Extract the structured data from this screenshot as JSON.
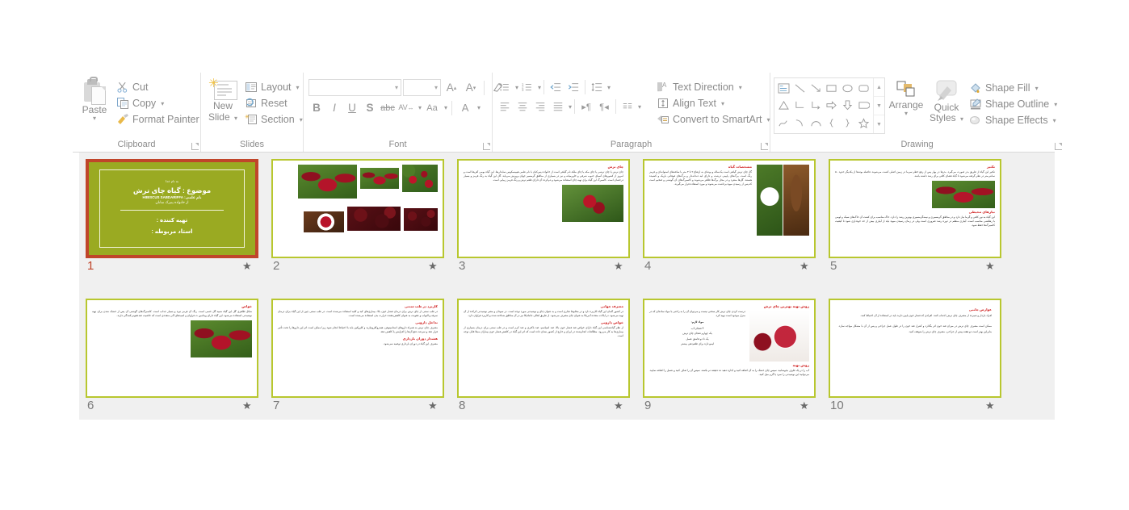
{
  "app": {
    "name": "PowerPoint Ribbon - Home Tab"
  },
  "ribbon": {
    "groups": [
      {
        "name": "Clipboard",
        "label": "Clipboard",
        "paste_label": "Paste",
        "commands": [
          {
            "label": "Cut",
            "icon": "scissors-icon"
          },
          {
            "label": "Copy",
            "icon": "copy-icon",
            "has_caret": true
          },
          {
            "label": "Format Painter",
            "icon": "format-painter-icon"
          }
        ]
      },
      {
        "name": "Slides",
        "label": "Slides",
        "new_slide_line1": "New",
        "new_slide_line2": "Slide",
        "commands": [
          {
            "label": "Layout",
            "icon": "layout-icon",
            "has_caret": true
          },
          {
            "label": "Reset",
            "icon": "reset-icon",
            "has_caret": false
          },
          {
            "label": "Section",
            "icon": "section-icon",
            "has_caret": true
          }
        ]
      },
      {
        "name": "Font",
        "label": "Font",
        "font_name_value": "",
        "font_name_placeholder": "",
        "font_size_value": "",
        "font_size_placeholder": "",
        "buttons_row1": [
          "increase-font-size",
          "decrease-font-size",
          "clear-formatting"
        ],
        "buttons_row2_labels": [
          "B",
          "I",
          "U",
          "S",
          "abc",
          "AV",
          "Aa",
          "A"
        ]
      },
      {
        "name": "Paragraph",
        "label": "Paragraph",
        "commands": [
          {
            "label": "Text Direction",
            "icon": "text-direction-icon",
            "has_caret": true
          },
          {
            "label": "Align Text",
            "icon": "align-text-icon",
            "has_caret": true
          },
          {
            "label": "Convert to SmartArt",
            "icon": "smartart-icon",
            "has_caret": true
          }
        ]
      },
      {
        "name": "Drawing",
        "label": "Drawing",
        "arrange_label": "Arrange",
        "quick_styles_line1": "Quick",
        "quick_styles_line2": "Styles",
        "commands": [
          {
            "label": "Shape Fill",
            "icon": "shape-fill-icon",
            "has_caret": true
          },
          {
            "label": "Shape Outline",
            "icon": "shape-outline-icon",
            "has_caret": true
          },
          {
            "label": "Shape Effects",
            "icon": "shape-effects-icon",
            "has_caret": true
          }
        ]
      }
    ]
  },
  "colors": {
    "selected_border": "#c0452a",
    "slide_border": "#b8c72f",
    "title_bg": "#9aaa22",
    "heading_red": "#cf1b1b",
    "workspace_bg": "#f0f0f0"
  },
  "slides": [
    {
      "number": "1",
      "selected": true,
      "has_animation": true,
      "type": "title",
      "bismillah": "به نام خدا",
      "title": "موضوع : گیاه چای ترش",
      "sci_label": "نام علمی: HIBISCUS SABDARIFFA",
      "family": "از خانواده پنیرک سانان",
      "prepared_by": "تهیه کننده :",
      "supervisor": "استاد مربوطه :"
    },
    {
      "number": "2",
      "selected": false,
      "has_animation": true,
      "type": "gallery",
      "images": [
        "hib",
        "leafy",
        "leafy",
        "dry",
        "dry",
        "cupwhite"
      ]
    },
    {
      "number": "3",
      "selected": false,
      "has_animation": true,
      "type": "text-image",
      "heading": "چای ترش",
      "body": "چای ترش یا چای ترشی یا چای مکه یا چای ملکه نام گیاهی است از خانواده پنیرکیان با نام علمی هیبیسکوس سابداریفا. این گیاه بومی آفریقا است و امروز از کشورهای آسیای جنوب شرقی و خاورمیانه و نیز در بسیاری از مناطق گرمسیر جهان پرورش می‌یابد. گل این گیاه به رنگ قرمز و بسیار درخشان است. کاسبرگ این گیاه برای تهیه چای استفاده می‌شود و دم‌کرده آن دارای طعم ترش و رنگ قرمز زیبایی است."
    },
    {
      "number": "4",
      "selected": false,
      "has_animation": true,
      "type": "image-text",
      "heading": "مشخصات گیاه",
      "body": "گل چای ترش گیاهی است یک‌ساله و بوته‌ای به ارتفاع ۲ تا ۳ متر با ساقه‌های استوانه‌ای و قرمز رنگ است. برگ‌های پایینی درشت و دارای لبه دندانه‌دار و برگ‌های فوقانی باریک و کشیده هستند. گل‌ها منفرد و در محل برگ‌ها ظاهر می‌شوند و کاسبرگ‌های آن گوشتی و ضخیم است که پس از رسیدن میوه برداشت می‌شوند و مورد استفاده قرار می‌گیرند."
    },
    {
      "number": "5",
      "selected": false,
      "has_animation": true,
      "type": "two-heading",
      "heading1": "تکثیر",
      "body1": "تکثیر این گیاه از طریق بذر صورت می‌گیرد. بذرها در بهار پس از رفع خطر سرما در زمین اصلی کشت می‌شوند. فاصله بوته‌ها از یکدیگر حدود ۵۰ سانتی‌متر در نظر گرفته می‌شود تا گیاه فضای کافی برای رشد داشته باشد.",
      "heading2": "نیازهای محیطی",
      "body2": "این گیاه به نور کافی و گرما نیاز دارد و در مناطق گرمسیری و نیمه‌گرمسیری بهترین رشد را دارد. خاک مناسب برای کشت آن خاک‌های سبک و لومی با زهکشی مناسب است. آبیاری منظم در دوره رشد ضروری است ولی در زمان رسیدن میوه باید از آبیاری بیش از حد خودداری شود تا کیفیت کاسبرگ‌ها حفظ شود."
    },
    {
      "number": "6",
      "selected": false,
      "has_animation": true,
      "type": "text-image",
      "heading": "خواص",
      "body": "شکل ظاهری گل این گیاه شبیه گل ختمی است. رنگ آن قرمز تیره و بسیار جذاب است. کاسبرگ‌های گوشتی آن پس از خشک شدن برای تهیه نوشیدنی استفاده می‌شود. این گیاه دارای ویتامین ث فراوان و اسیدهای آلی متعددی است که خاصیت ضدعفونی‌کنندگی دارند."
    },
    {
      "number": "7",
      "selected": false,
      "has_animation": true,
      "type": "multi-heading",
      "sections": [
        {
          "heading": "کاربرد در طب سنتی",
          "body": "در طب سنتی از چای ترش برای درمان فشار خون بالا، بیماری‌های کبد و کلیه استفاده می‌شده است. در طب سنتی چین از این گیاه برای درمان سرفه و التهاب و عفونت به عنوان کاهش‌دهنده حرارت بدن استفاده می‌شده است."
        },
        {
          "heading": "تداخل دارویی",
          "body": "مصرف چای ترش به همراه داروهای استامینوفن، هیدروکلروتیازید و کلروکین باید با احتیاط انجام شود زیرا ممکن است اثر این داروها را تحت تأثیر قرار دهد و سرعت دفع آن‌ها را افزایش یا کاهش دهد."
        },
        {
          "heading": "هشدار دوران بارداری",
          "body": "مصرف این گیاه در دوران بارداری توصیه نمی‌شود."
        }
      ]
    },
    {
      "number": "8",
      "selected": false,
      "has_animation": true,
      "type": "multi-heading",
      "sections": [
        {
          "heading": "مصرف جهانی",
          "body": "در کشور آلمان این گیاه کاربرد دارد و در مخلوط تجاری است و به عنوان چای و نوشیدنی مورد توجه است. در سودان و مصر نوشیدنی کرکده از آن تهیه می‌شود. در ایالات متحده آمریکا به عنوان چای مصرف می‌شود. از طریق اهالی جامائیکا نیز در آن مناطق شناخته شده و کاربرد فراوان دارد."
        },
        {
          "heading": "خواص دارویی",
          "body": "از نظر گیاه‌شناسی این گیاه دارای خواص ضد فشار خون بالا، ضد اسپاسم، ضد باکتری و ضد کرم است و در طب سنتی برای درمان بسیاری از بیماری‌ها به کار می‌رود. مطالعات انجام‌شده در ایران و خارج از کشور نشان داده است که اثر این گیاه در کاهش فشار خون بیماران مبتلا قابل توجه است."
        }
      ]
    },
    {
      "number": "9",
      "selected": false,
      "has_animation": true,
      "type": "recipe",
      "heading1": "روش تهیه بهترین چای ترش",
      "intro": "درست کردن چای ترش کار سختی نیست و می‌توان آن را به راحتی با مواد ساده‌ای که در منزل موجود است تهیه کرد.",
      "materials_label": "مواد لازم:",
      "materials": [
        "۴ فنجان آب",
        "یک چهارم فنجان چای ترش",
        "یک تا دو قاشق عسل",
        "لیمو تازه برای طعم‌دهی بیشتر"
      ],
      "heading2": "روش تهیه",
      "body2": "آب را در یک ظرف بجوشانید، سپس چای خشک را به آن اضافه کنید و اجازه دهید ده دقیقه دم بکشد. سپس آن را صاف کنید و عسل را اضافه نمایید. می‌توانید این نوشیدنی را سرد یا گرم میل کنید."
    },
    {
      "number": "10",
      "selected": false,
      "has_animation": true,
      "type": "text-only",
      "heading": "عوارض جانبی",
      "body1": "افراد باردار و شیرده از مصرف چای ترش اجتناب کنند. افرادی که فشار خون پایین دارند باید در استفاده از آن احتیاط کنند.",
      "body2": "ممکن است مصرف چای ترش در میزان قند خون اثر بگذارد و کنترل قند خون را در طول عمل جراحی و پس از آن با مشکل مواجه سازد. بنابراین بهتر است دو هفته پیش از جراحی، مصرف چای ترش را متوقف کنید."
    }
  ]
}
